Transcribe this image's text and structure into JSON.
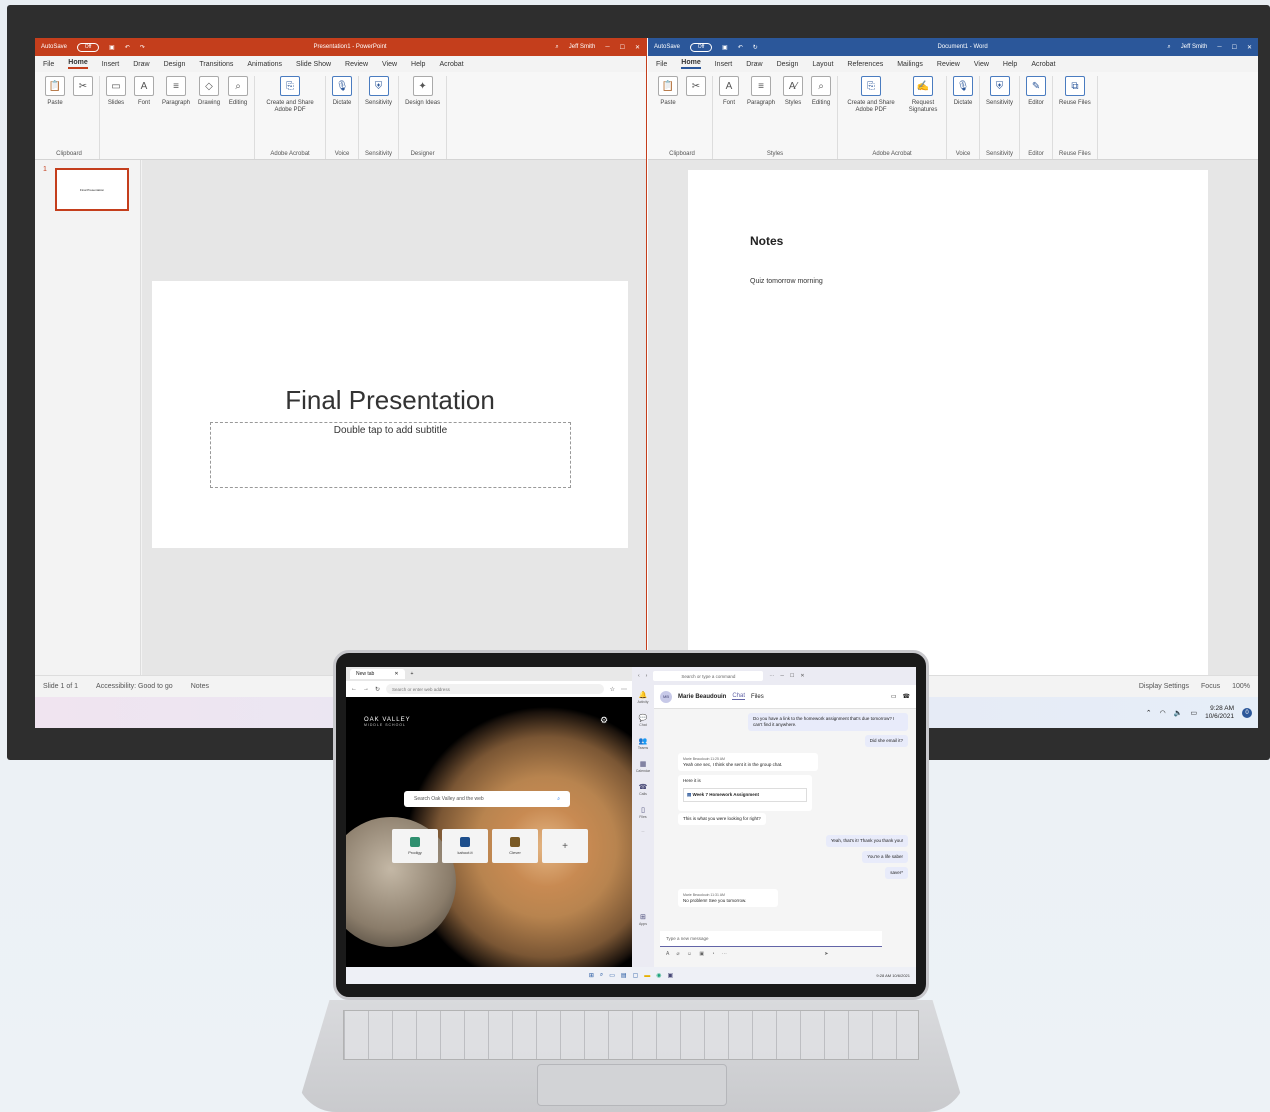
{
  "ppt": {
    "autosave": "AutoSave",
    "autosave_state": "Off",
    "title": "Presentation1 - PowerPoint",
    "user": "Jeff Smith",
    "menu": [
      "File",
      "Home",
      "Insert",
      "Draw",
      "Design",
      "Transitions",
      "Animations",
      "Slide Show",
      "Review",
      "View",
      "Help",
      "Acrobat"
    ],
    "groups": [
      {
        "label": "Clipboard",
        "buttons": [
          "Paste"
        ]
      },
      {
        "label": "",
        "buttons": [
          "Slides",
          "Font",
          "Paragraph",
          "Drawing",
          "Editing"
        ]
      },
      {
        "label": "Adobe Acrobat",
        "buttons": [
          "Create and Share Adobe PDF"
        ]
      },
      {
        "label": "Voice",
        "buttons": [
          "Dictate"
        ]
      },
      {
        "label": "Sensitivity",
        "buttons": [
          "Sensitivity"
        ]
      },
      {
        "label": "Designer",
        "buttons": [
          "Design Ideas"
        ]
      }
    ],
    "slide_number": "1",
    "slide_title": "Final Presentation",
    "slide_subtitle": "Double tap to add subtitle",
    "status": {
      "slide": "Slide 1 of 1",
      "accessibility": "Accessibility: Good to go",
      "notes": "Notes"
    }
  },
  "word": {
    "autosave": "AutoSave",
    "autosave_state": "Off",
    "title": "Document1 - Word",
    "user": "Jeff Smith",
    "menu": [
      "File",
      "Home",
      "Insert",
      "Draw",
      "Design",
      "Layout",
      "References",
      "Mailings",
      "Review",
      "View",
      "Help",
      "Acrobat"
    ],
    "groups": [
      {
        "label": "Clipboard",
        "buttons": [
          "Paste"
        ]
      },
      {
        "label": "Styles",
        "buttons": [
          "Font",
          "Paragraph",
          "Styles",
          "Editing"
        ]
      },
      {
        "label": "Adobe Acrobat",
        "buttons": [
          "Create and Share Adobe PDF",
          "Request Signatures"
        ]
      },
      {
        "label": "Voice",
        "buttons": [
          "Dictate"
        ]
      },
      {
        "label": "Sensitivity",
        "buttons": [
          "Sensitivity"
        ]
      },
      {
        "label": "Editor",
        "buttons": [
          "Editor"
        ]
      },
      {
        "label": "Reuse Files",
        "buttons": [
          "Reuse Files"
        ]
      }
    ],
    "heading": "Notes",
    "body": "Quiz tomorrow morning",
    "status": {
      "display": "Display Settings",
      "focus": "Focus",
      "zoom": "100%"
    }
  },
  "taskbar": {
    "time": "9:28 AM",
    "date": "10/6/2021",
    "badge": "0"
  },
  "edge": {
    "tab": "New tab",
    "address_placeholder": "Search or enter web address",
    "school": "OAK VALLEY",
    "school_sub": "MIDDLE SCHOOL",
    "search_placeholder": "Search Oak Valley and the web",
    "tiles": [
      {
        "label": "Prodigy",
        "color": "#2f8f6f"
      },
      {
        "label": "kahoot.it",
        "color": "#1e4f8c"
      },
      {
        "label": "Clever",
        "color": "#7a5a26"
      }
    ]
  },
  "teams": {
    "search": "Search or type a command",
    "contact": "Marie Beaudouin",
    "tabs": [
      "Chat",
      "Files"
    ],
    "rail": [
      "Activity",
      "Chat",
      "Teams",
      "Calendar",
      "Calls",
      "Files",
      "...",
      "Apps"
    ],
    "messages": [
      {
        "from": "me",
        "text": "Do you have a link to the homework assignment that's due tomorrow? I can't find it anywhere."
      },
      {
        "from": "me",
        "text": "Did she email it?"
      },
      {
        "from": "them",
        "meta": "Marie Beaudouin   11:25 AM",
        "text": "Yeah one sec, I think she sent it in the group chat."
      },
      {
        "from": "them",
        "text": "Here it is"
      },
      {
        "from": "them",
        "text": "Week 7 Homework Assignment"
      },
      {
        "from": "them",
        "text": "This is what you were looking for right?"
      },
      {
        "from": "me",
        "text": "Yeah, that's it! Thank you thank you!"
      },
      {
        "from": "me",
        "text": "You're a life saber"
      },
      {
        "from": "me",
        "text": "saver*"
      },
      {
        "from": "them",
        "meta": "Marie Beaudouin   11:31 AM",
        "text": "No problem! See you tomorrow."
      }
    ],
    "compose_placeholder": "Type a new message"
  }
}
